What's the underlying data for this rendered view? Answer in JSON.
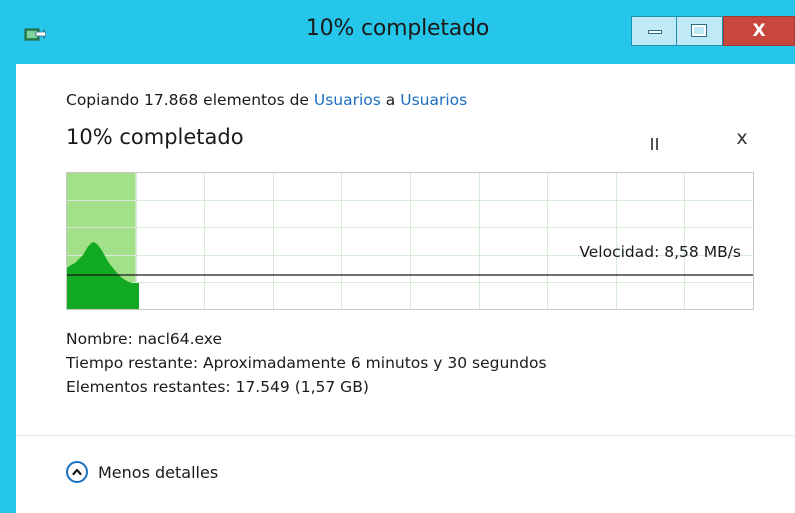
{
  "window": {
    "title": "10% completado",
    "close_glyph": "X"
  },
  "copy": {
    "prefix": "Copiando 17.868 elementos de ",
    "source": "Usuarios",
    "middle": " a ",
    "destination": "Usuarios"
  },
  "progress": {
    "title": "10% completado",
    "percent": 10,
    "speed": "Velocidad: 8,58 MB/s",
    "cancel_glyph": "x"
  },
  "details": {
    "name": "Nombre:  nacl64.exe",
    "time": "Tiempo restante:  Aproximadamente 6 minutos y 30 segundos",
    "items": "Elementos restantes:  17.549 (1,57 GB)"
  },
  "toggle": {
    "label": "Menos detalles"
  },
  "colors": {
    "titlebar": "#26c5ea",
    "progress_fill": "#a3e08a",
    "speed_fill": "#12aa22",
    "link": "#1a6ec5",
    "close_button": "#c7473d"
  },
  "icons": [
    "copy-icon",
    "minimize-icon",
    "maximize-icon",
    "close-icon",
    "pause-icon",
    "cancel-icon",
    "chevron-up-icon"
  ]
}
